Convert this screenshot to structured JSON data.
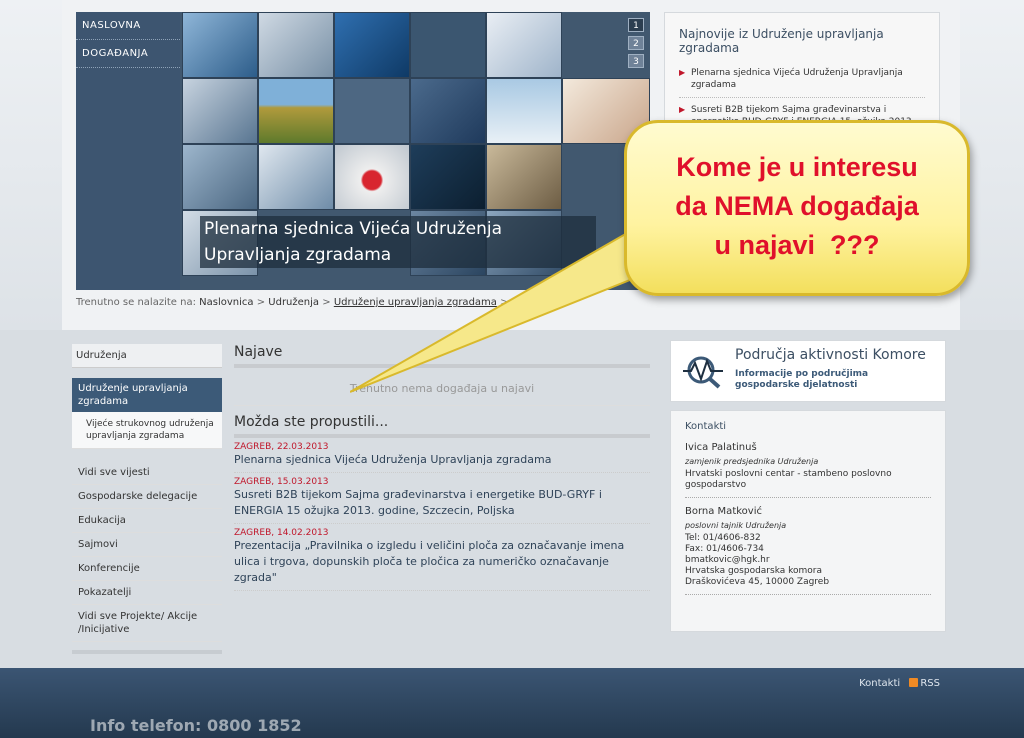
{
  "hero": {
    "nav": [
      "NASLOVNA",
      "DOGAĐANJA"
    ],
    "pages": [
      "1",
      "2",
      "3"
    ],
    "caption": "Plenarna sjednica Vijeća Udruženja Upravljanja zgradama"
  },
  "news": {
    "title": "Najnovije iz Udruženje upravljanja zgradama",
    "items": [
      "Plenarna sjednica Vijeća Udruženja Upravljanja zgradama",
      "Susreti B2B tijekom Sajma građevinarstva i energetike BUD-GRYF i ENERGIA 15. ožujka 2013. godine, Szczecin, Poljska"
    ]
  },
  "breadcrumb": {
    "prefix": "Trenutno se nalazite na:",
    "items": [
      "Naslovnica",
      "Udruženja",
      "Udruženje upravljanja zgradama"
    ],
    "sep": ">"
  },
  "callout": {
    "lines": [
      "Kome je u interesu",
      "da NEMA događaja",
      "u najavi  ???"
    ]
  },
  "sidebar": {
    "title": "Udruženja",
    "active": "Udruženje upravljanja zgradama",
    "sub": "Vijeće strukovnog udruženja upravljanja zgradama",
    "items": [
      "Vidi sve vijesti",
      "Gospodarske delegacije",
      "Edukacija",
      "Sajmovi",
      "Konferencije",
      "Pokazatelji",
      "Vidi sve Projekte/ Akcije /Inicijative"
    ]
  },
  "main": {
    "najave_title": "Najave",
    "empty": "Trenutno nema događaja u najavi",
    "missed_title": "Možda ste propustili...",
    "entries": [
      {
        "date": "ZAGREB, 22.03.2013",
        "title": "Plenarna sjednica Vijeća Udruženja Upravljanja zgradama"
      },
      {
        "date": "ZAGREB, 15.03.2013",
        "title": "Susreti B2B tijekom Sajma građevinarstva i energetike BUD-GRYF i ENERGIA 15 ožujka 2013. godine, Szczecin, Poljska"
      },
      {
        "date": "ZAGREB, 14.02.2013",
        "title": "Prezentacija „Pravilnika o izgledu i veličini ploča za označavanje imena ulica i trgova, dopunskih ploča te pločica za numeričko označavanje zgrada\""
      }
    ]
  },
  "right": {
    "area_title": "Područja aktivnosti Komore",
    "area_sub": "Informacije po područjima gospodarske djelatnosti",
    "contacts_title": "Kontakti",
    "person1": {
      "name": "Ivica Palatinuš",
      "role": "zamjenik predsjednika Udruženja",
      "org": "Hrvatski poslovni centar - stambeno poslovno gospodarstvo"
    },
    "person2": {
      "name": "Borna Matković",
      "role": "poslovni tajnik Udruženja",
      "tel": "Tel: 01/4606-832",
      "fax": "Fax: 01/4606-734",
      "email": "bmatkovic@hgk.hr",
      "org": "Hrvatska gospodarska komora",
      "address": "Draškovićeva 45, 10000 Zagreb"
    }
  },
  "footer": {
    "contacts": "Kontakti",
    "rss": "RSS",
    "info": "Info telefon: 0800 1852"
  },
  "colors": {
    "accent_red": "#c0172b",
    "nav_blue": "#3c5a78",
    "callout_yellow": "#fff3a0"
  }
}
